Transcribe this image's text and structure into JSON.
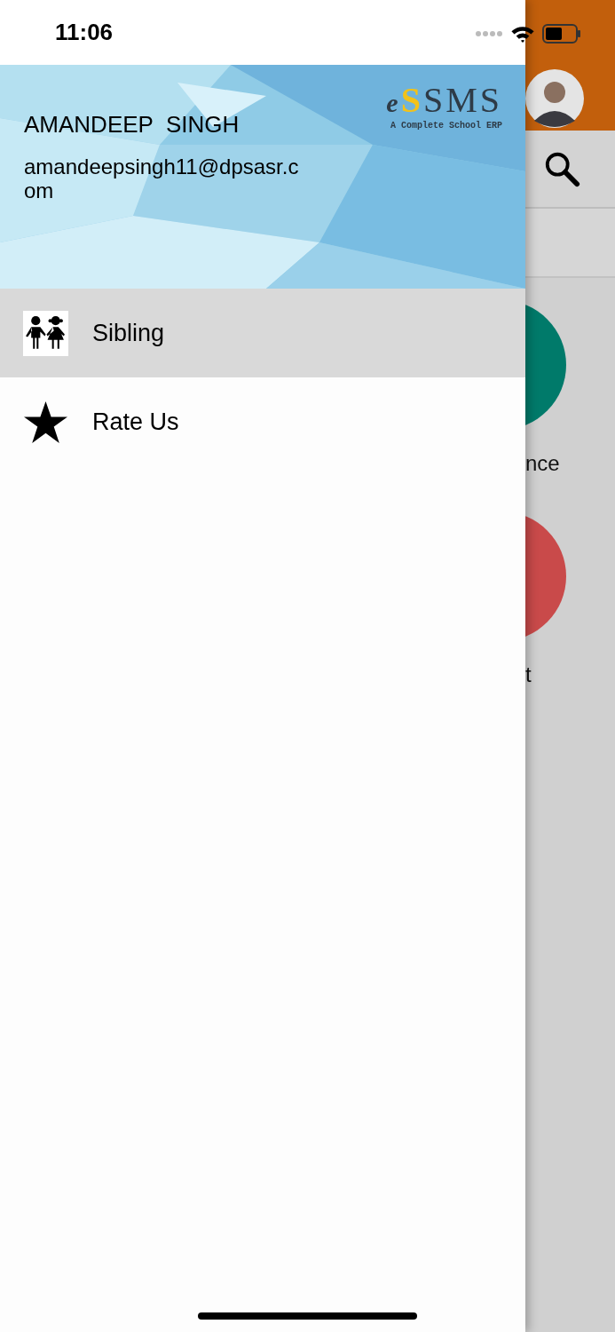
{
  "status_bar": {
    "time": "11:06"
  },
  "drawer": {
    "header": {
      "kind": "picture",
      "logo_mark": "e",
      "logo_accent": "S",
      "logo_text": "SMS",
      "tagline": "A Complete School ERP",
      "user_name": "AMANDEEP  SINGH",
      "email": "amandeepsingh11@dpsasr.com"
    },
    "items": [
      {
        "label": "Sibling",
        "kind": "children",
        "selected": true
      },
      {
        "label": "Rate Us",
        "kind": "star",
        "selected": false
      }
    ]
  },
  "background_screen": {
    "tiles": [
      {
        "label": "nce",
        "color": "#007a6a"
      },
      {
        "label": "t",
        "color": "#c94a4a"
      }
    ]
  }
}
